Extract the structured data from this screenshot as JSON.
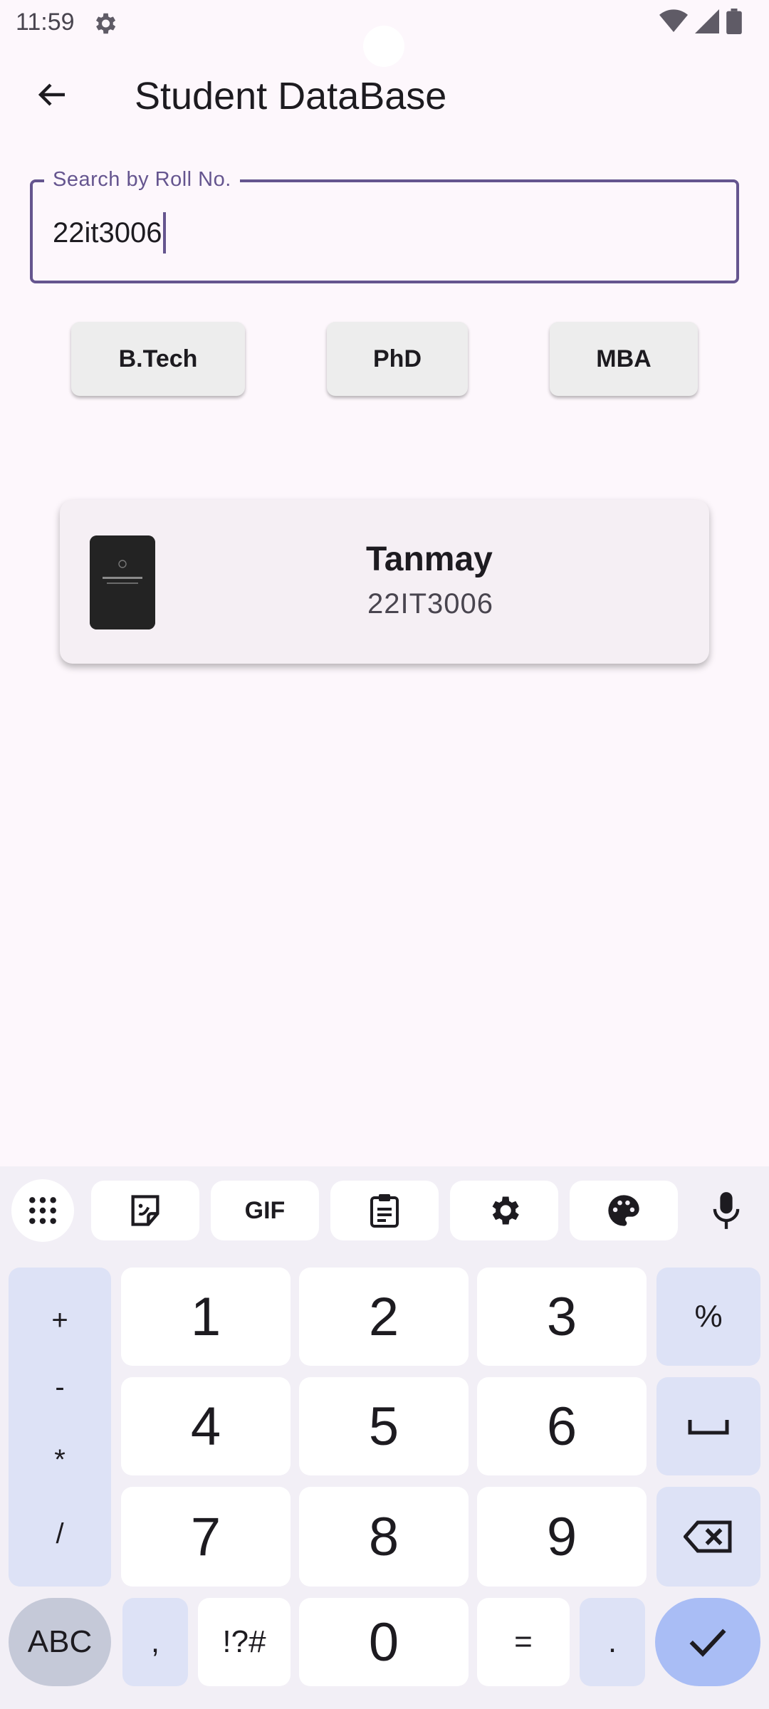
{
  "status_bar": {
    "time": "11:59",
    "icons": [
      "settings-gear-icon",
      "wifi-icon",
      "signal-icon",
      "battery-icon"
    ]
  },
  "app_bar": {
    "title": "Student DataBase",
    "back_icon": "arrow-back-icon"
  },
  "search": {
    "label": "Search by Roll No.",
    "value": "22it3006",
    "accent_color": "#65558f"
  },
  "filters": [
    {
      "label": "B.Tech"
    },
    {
      "label": "PhD"
    },
    {
      "label": "MBA"
    }
  ],
  "results": [
    {
      "name": "Tanmay",
      "roll_no": "22IT3006",
      "avatar": "student-photo"
    }
  ],
  "keyboard": {
    "toolbar": [
      "apps-grid-icon",
      "sticker-icon",
      "gif-icon",
      "clipboard-icon",
      "settings-icon",
      "palette-icon",
      "mic-icon"
    ],
    "gif_label": "GIF",
    "symbols": [
      "+",
      "-",
      "*",
      "/"
    ],
    "digits": [
      "1",
      "2",
      "3",
      "4",
      "5",
      "6",
      "7",
      "8",
      "9"
    ],
    "percent": "%",
    "abc": "ABC",
    "comma": ",",
    "special": "!?#",
    "zero": "0",
    "equals": "=",
    "period": ".",
    "icons": [
      "space-icon",
      "backspace-icon",
      "check-icon"
    ]
  }
}
